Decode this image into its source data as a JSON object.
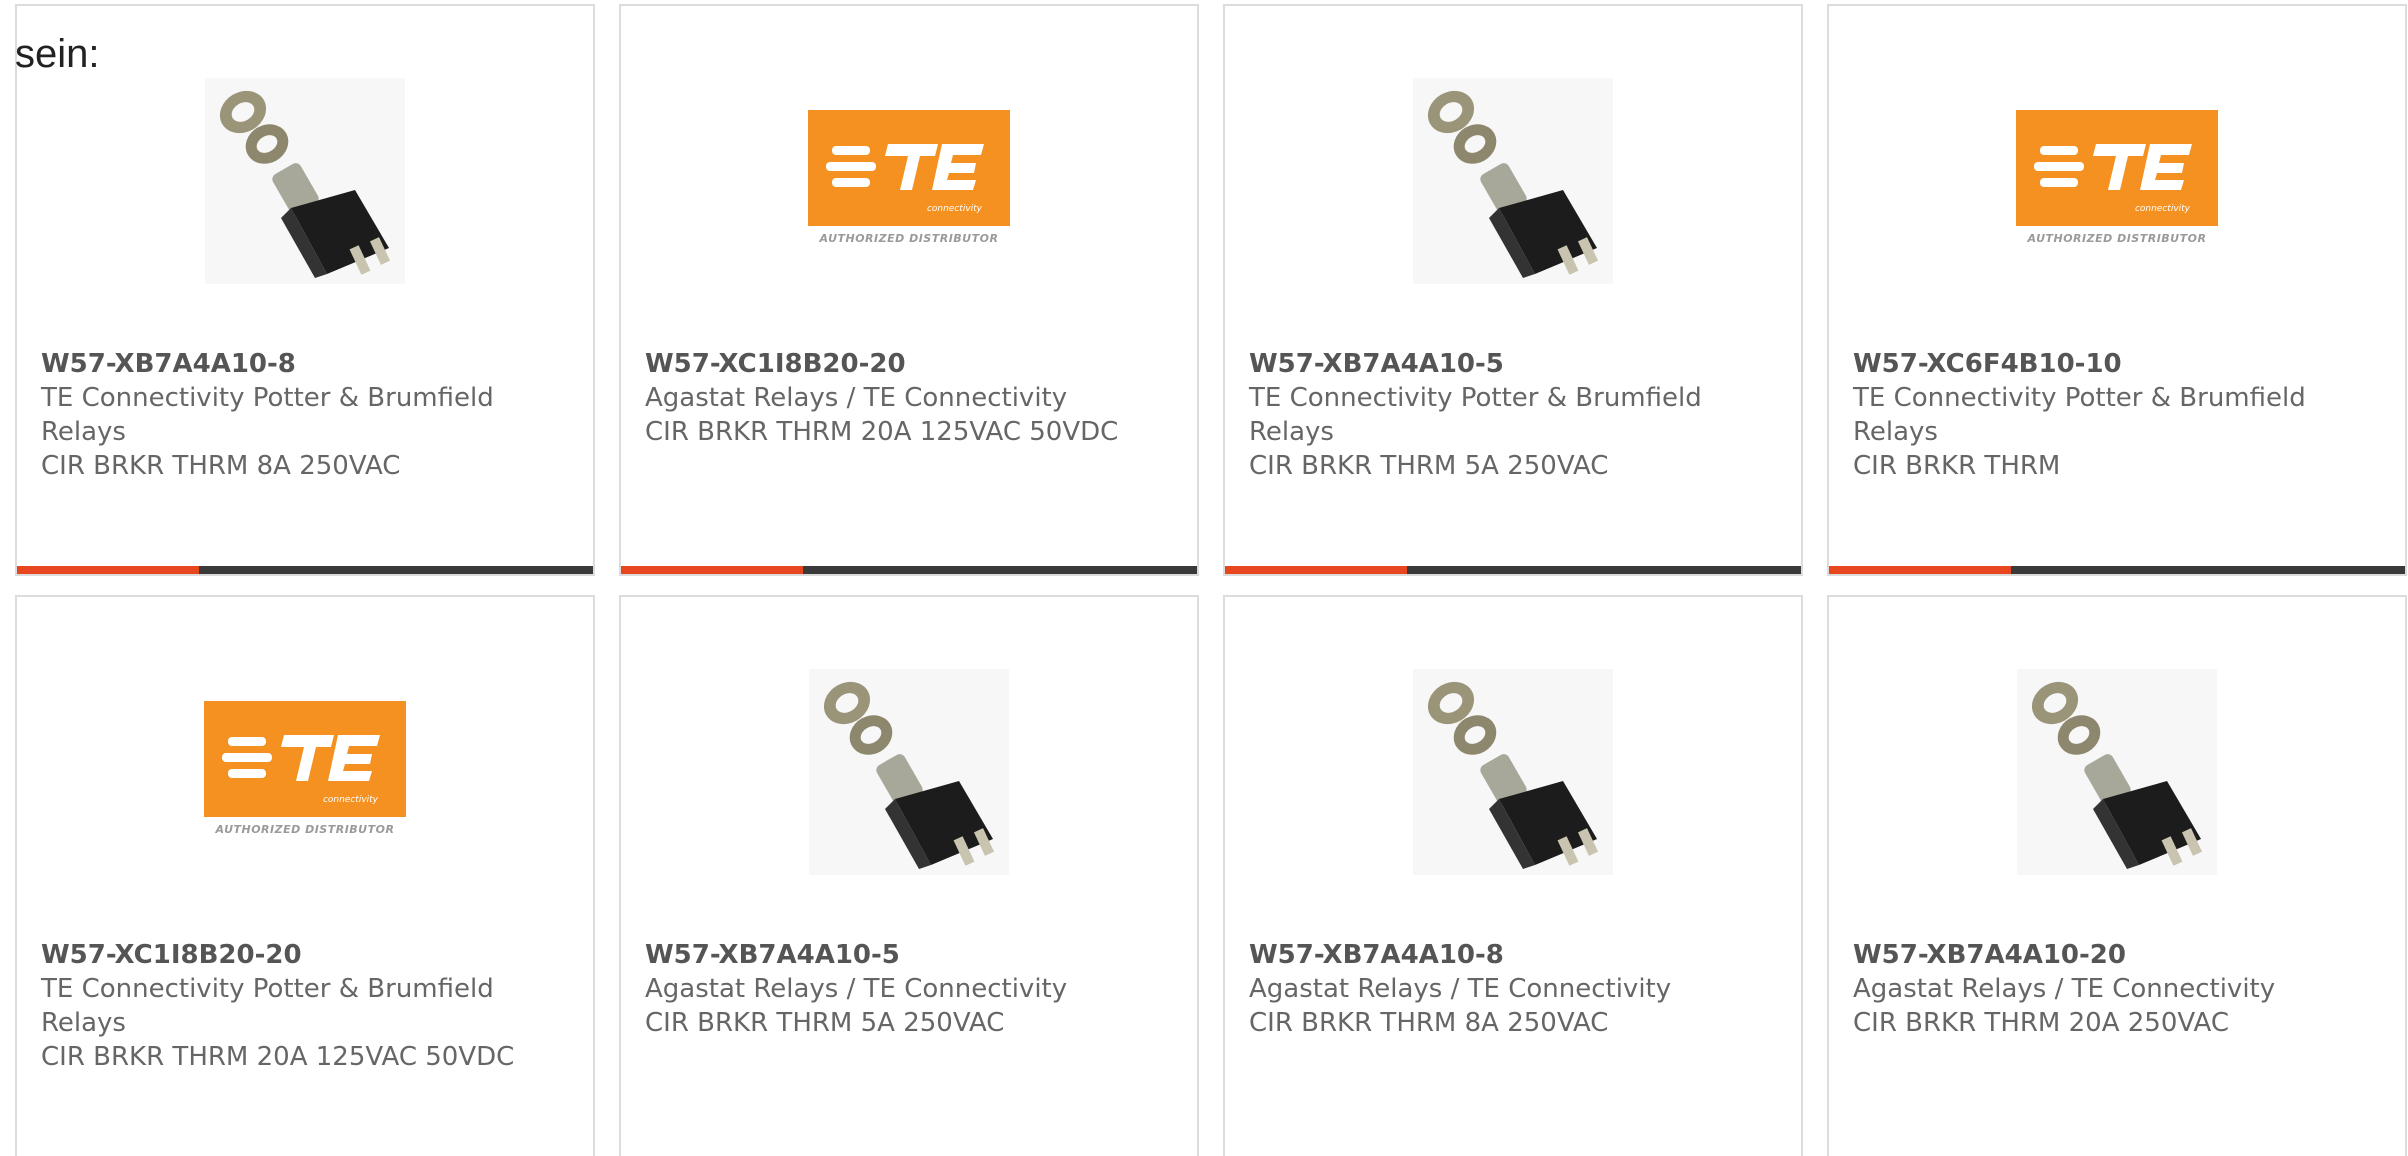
{
  "intro_text": "sein:",
  "products": [
    {
      "part_number": "W57-XB7A4A10-8",
      "manufacturer": "TE Connectivity Potter & Brumfield Relays",
      "description": "CIR BRKR THRM 8A 250VAC",
      "image": "circuit-breaker-photo"
    },
    {
      "part_number": "W57-XC1I8B20-20",
      "manufacturer": "Agastat Relays / TE Connectivity",
      "description": "CIR BRKR THRM 20A 125VAC 50VDC",
      "image": "te-connectivity-logo",
      "logo_caption": "AUTHORIZED DISTRIBUTOR",
      "logo_sub": "connectivity"
    },
    {
      "part_number": "W57-XB7A4A10-5",
      "manufacturer": "TE Connectivity Potter & Brumfield Relays",
      "description": "CIR BRKR THRM 5A 250VAC",
      "image": "circuit-breaker-photo"
    },
    {
      "part_number": "W57-XC6F4B10-10",
      "manufacturer": "TE Connectivity Potter & Brumfield Relays",
      "description": "CIR BRKR THRM",
      "image": "te-connectivity-logo",
      "logo_caption": "AUTHORIZED DISTRIBUTOR",
      "logo_sub": "connectivity"
    },
    {
      "part_number": "W57-XC1I8B20-20",
      "manufacturer": "TE Connectivity Potter & Brumfield Relays",
      "description": "CIR BRKR THRM 20A 125VAC 50VDC",
      "image": "te-connectivity-logo",
      "logo_caption": "AUTHORIZED DISTRIBUTOR",
      "logo_sub": "connectivity"
    },
    {
      "part_number": "W57-XB7A4A10-5",
      "manufacturer": "Agastat Relays / TE Connectivity",
      "description": "CIR BRKR THRM 5A 250VAC",
      "image": "circuit-breaker-photo"
    },
    {
      "part_number": "W57-XB7A4A10-8",
      "manufacturer": "Agastat Relays / TE Connectivity",
      "description": "CIR BRKR THRM 8A 250VAC",
      "image": "circuit-breaker-photo"
    },
    {
      "part_number": "W57-XB7A4A10-20",
      "manufacturer": "Agastat Relays / TE Connectivity",
      "description": "CIR BRKR THRM 20A 250VAC",
      "image": "circuit-breaker-photo"
    }
  ],
  "colors": {
    "accent": "#e8461e",
    "bar": "#3a3a3a",
    "te_orange": "#f59121",
    "text": "#666666"
  }
}
